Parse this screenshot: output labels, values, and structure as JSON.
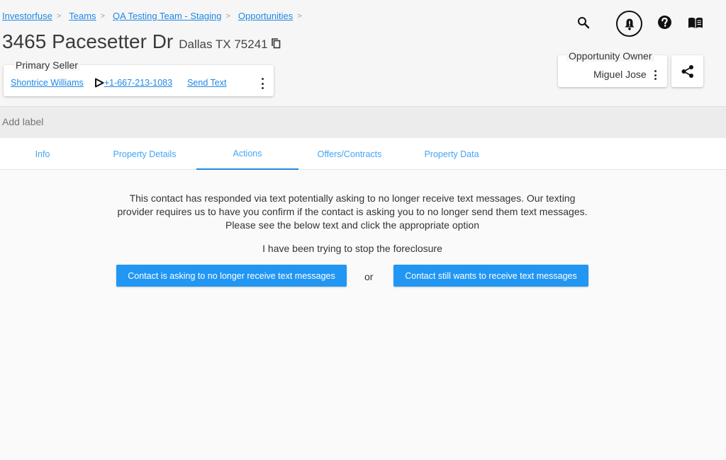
{
  "breadcrumb": [
    "Investorfuse",
    "Teams",
    "QA Testing Team - Staging",
    "Opportunities"
  ],
  "property": {
    "address": "3465 Pacesetter Dr",
    "city_state_zip": "Dallas TX 75241"
  },
  "primary_seller": {
    "legend": "Primary Seller",
    "name": "Shontrice Williams",
    "phone": "+1-667-213-1083",
    "send_text": "Send Text"
  },
  "opportunity_owner": {
    "legend": "Opportunity Owner",
    "name": "Miguel Jose"
  },
  "header_icons": [
    "search-icon",
    "bell-icon",
    "help-icon",
    "book-icon",
    "share-icon"
  ],
  "label_bar": {
    "placeholder": "Add label"
  },
  "tabs": [
    {
      "label": "Info"
    },
    {
      "label": "Property Details"
    },
    {
      "label": "Actions",
      "active": true
    },
    {
      "label": "Offers/Contracts"
    },
    {
      "label": "Property Data"
    }
  ],
  "actions": {
    "message_lines": [
      "This contact has responded via text potentially asking to no longer receive text messages. Our texting",
      "provider requires us to have you confirm if the contact is asking you to no longer send them text messages.",
      "Please see the below text and click the appropriate option"
    ],
    "quoted_text": "I have been trying to stop the foreclosure",
    "stop_button": "Contact is asking to no longer receive text messages",
    "or_label": "or",
    "continue_button": "Contact still wants to receive text messages"
  },
  "colors": {
    "accent": "#2196f3",
    "link": "#1e88e5",
    "tab_text": "#42a5f5"
  }
}
